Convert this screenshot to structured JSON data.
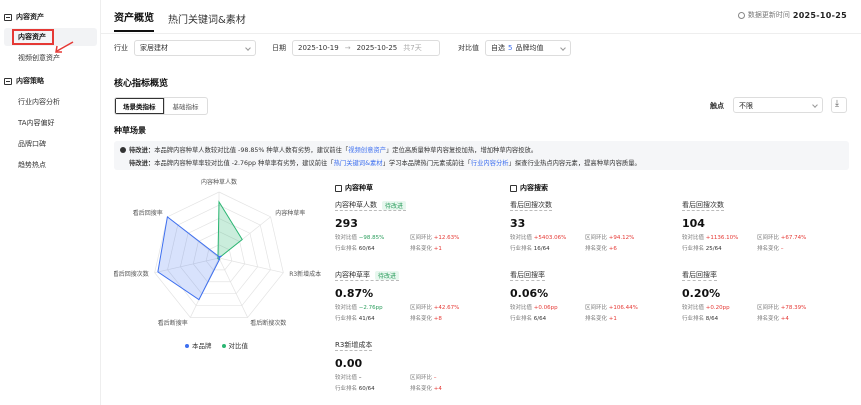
{
  "sidebar": {
    "group1": "内容资产",
    "item_active": "内容资产",
    "item2": "视频创意资产",
    "group2": "内容策略",
    "items": [
      "行业内容分析",
      "TA内容偏好",
      "品牌口碑",
      "趋势热点"
    ]
  },
  "header": {
    "tabs": [
      "资产概览",
      "热门关键词&素材"
    ],
    "update_label": "数据更新时间",
    "update_date": "2025-10-25"
  },
  "filters": {
    "industry_label": "行业",
    "industry_value": "家居建材",
    "date_label": "日期",
    "date_start": "2025-10-19",
    "date_sep": "→",
    "date_end": "2025-10-25",
    "date_hint": "共7天",
    "compare_label": "对比值",
    "compare_prefix": "自选",
    "compare_num": "5",
    "compare_suffix": "品牌均值"
  },
  "section": {
    "title": "核心指标概览",
    "seg": [
      "场景类指标",
      "基础指标"
    ],
    "touch_label": "触点",
    "touch_value": "不限",
    "sub_title": "种草场景"
  },
  "tips": [
    {
      "a": "待改进：",
      "b": "本品牌内容种草人数较对比值 -98.85% 种草人数有劣势，建议前往「",
      "link": "视频创意资产",
      "c": "」定位高质量种草内容复投加热，增加种草内容投放。"
    },
    {
      "a": "待改进：",
      "b": "本品牌内容种草率较对比值 -2.76pp 种草率有劣势，建议前往「",
      "link": "热门关键词&素材",
      "c": "」学习本品牌热门元素或前往「",
      "link2": "行业内容分析",
      "d": "」探查行业热点内容元素，提高种草内容质量。"
    }
  ],
  "radar_labels": [
    "内容种草人数",
    "内容种草率",
    "R3新增成本",
    "看后断搜次数",
    "看后断搜率",
    "看后回搜次数",
    "看后回搜率"
  ],
  "legend": [
    "本品牌",
    "对比值"
  ],
  "colors": {
    "brand": "#3d6ff0",
    "compare": "#2bb673",
    "accent_red": "#e53935"
  },
  "col_heads": [
    "内容种草",
    "内容搜索"
  ],
  "cards": [
    {
      "name": "内容种草人数",
      "badge": "待改进",
      "value": "293",
      "r1a": "较对比值",
      "r1b": "−98.85%",
      "r1c": "区间环比",
      "r1d": "+12.63%",
      "r2a": "行业排名",
      "r2b": "60/64",
      "r2c": "排名变化",
      "r2d": "+1"
    },
    {
      "name": "看后回搜次数",
      "badge": "",
      "value": "33",
      "r1a": "较对比值",
      "r1b": "+5403.06%",
      "r1c": "区间环比",
      "r1d": "+94.12%",
      "r2a": "行业排名",
      "r2b": "16/64",
      "r2c": "排名变化",
      "r2d": "+6"
    },
    {
      "name": "看后回搜次数",
      "badge": "",
      "value": "104",
      "r1a": "较对比值",
      "r1b": "+1136.10%",
      "r1c": "区间环比",
      "r1d": "+67.74%",
      "r2a": "行业排名",
      "r2b": "25/64",
      "r2c": "排名变化",
      "r2d": "–"
    },
    {
      "name": "内容种草率",
      "badge": "待改进",
      "value": "0.87%",
      "r1a": "较对比值",
      "r1b": "−2.76pp",
      "r1c": "区间环比",
      "r1d": "+42.67%",
      "r2a": "行业排名",
      "r2b": "41/64",
      "r2c": "排名变化",
      "r2d": "+8"
    },
    {
      "name": "看后回搜率",
      "badge": "",
      "value": "0.06%",
      "r1a": "较对比值",
      "r1b": "+0.06pp",
      "r1c": "区间环比",
      "r1d": "+106.44%",
      "r2a": "行业排名",
      "r2b": "6/64",
      "r2c": "排名变化",
      "r2d": "+1"
    },
    {
      "name": "看后回搜率",
      "badge": "",
      "value": "0.20%",
      "r1a": "较对比值",
      "r1b": "+0.20pp",
      "r1c": "区间环比",
      "r1d": "+78.39%",
      "r2a": "行业排名",
      "r2b": "8/64",
      "r2c": "排名变化",
      "r2d": "+4"
    },
    {
      "name": "R3新增成本",
      "badge": "",
      "value": "0.00",
      "r1a": "较对比值",
      "r1b": "–",
      "r1c": "区间环比",
      "r1d": "–",
      "r2a": "行业排名",
      "r2b": "60/64",
      "r2c": "排名变化",
      "r2d": "+4"
    }
  ]
}
